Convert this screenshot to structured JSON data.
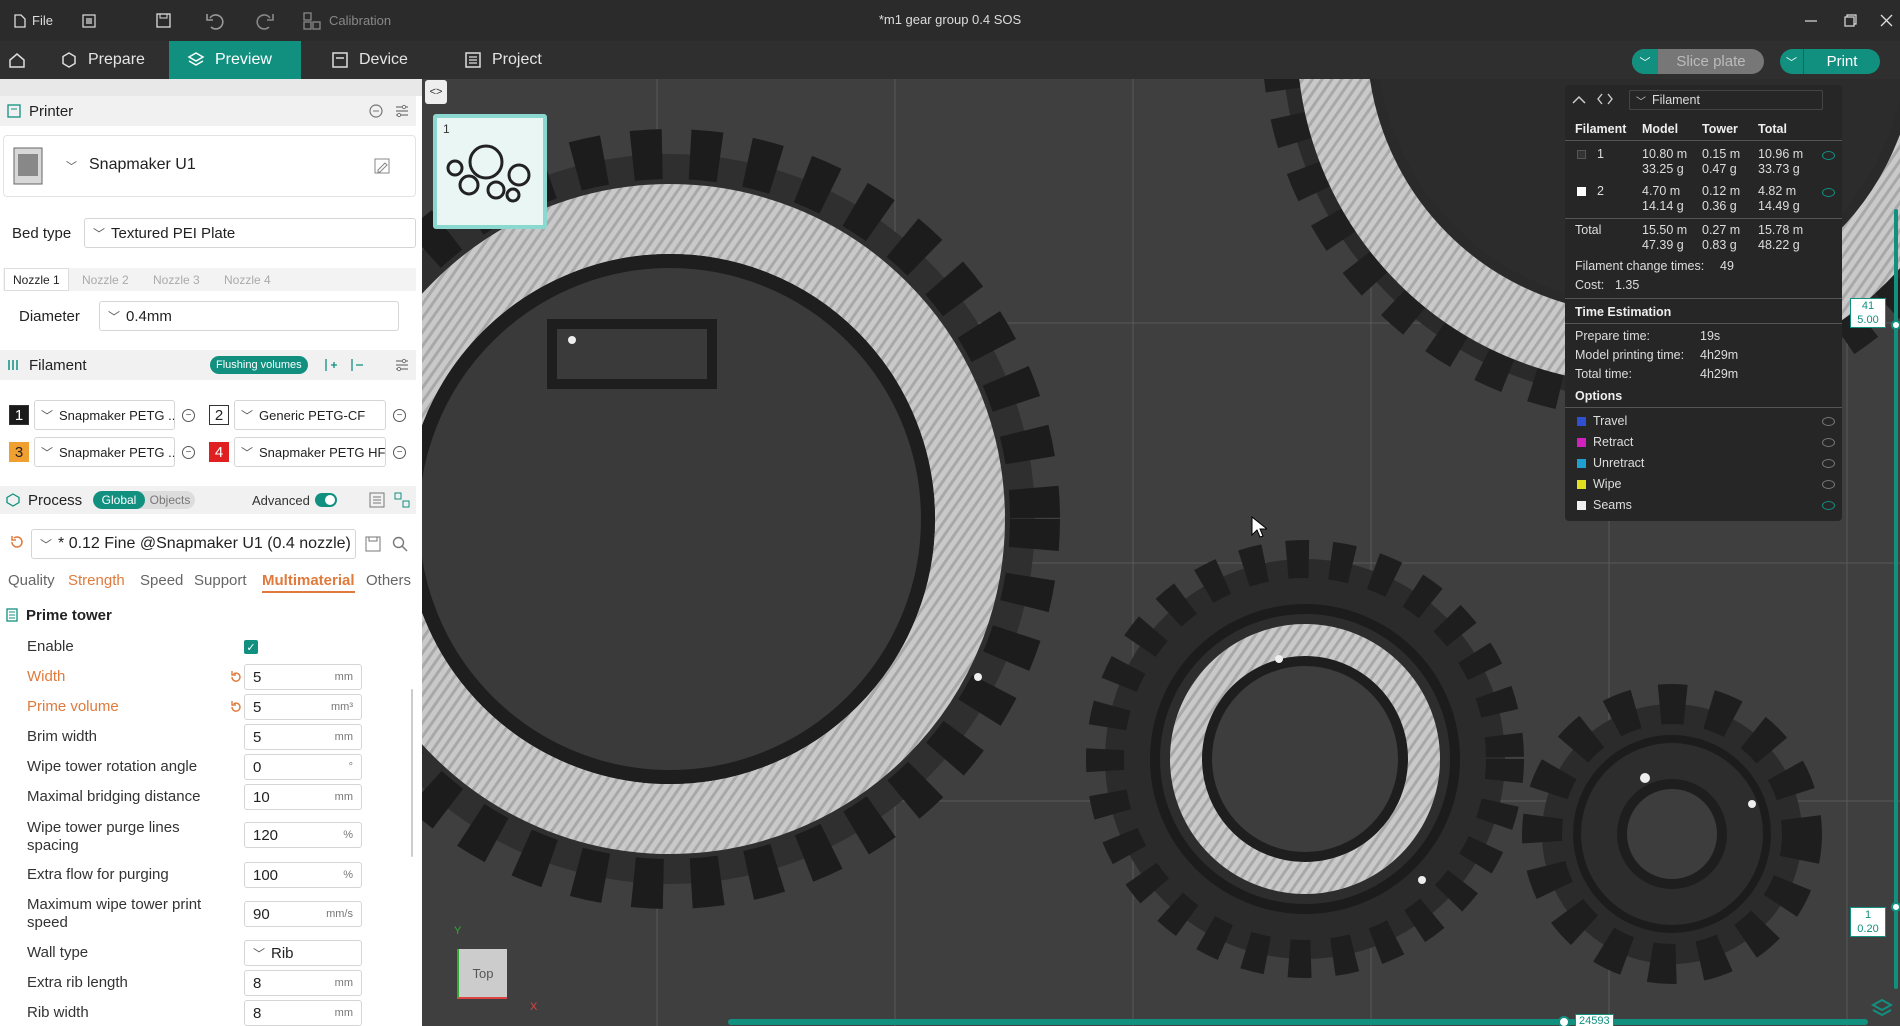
{
  "titlebar": {
    "file_label": "File",
    "calibration_label": "Calibration",
    "window_title": "*m1 gear group 0.4 SOS"
  },
  "tabs": [
    {
      "label": "Prepare"
    },
    {
      "label": "Preview"
    },
    {
      "label": "Device"
    },
    {
      "label": "Project"
    }
  ],
  "actions": {
    "slice_label": "Slice plate",
    "print_label": "Print"
  },
  "printer": {
    "section_title": "Printer",
    "name": "Snapmaker U1",
    "bed_type_label": "Bed type",
    "bed_type_value": "Textured PEI Plate",
    "nozzle_tabs": [
      "Nozzle 1",
      "Nozzle 2",
      "Nozzle 3",
      "Nozzle 4"
    ],
    "diameter_label": "Diameter",
    "diameter_value": "0.4mm"
  },
  "filament": {
    "section_title": "Filament",
    "flushing_label": "Flushing volumes",
    "slots": [
      {
        "num": "1",
        "name": "Snapmaker PETG ...",
        "color": "#1a1a1a",
        "text": "#fff"
      },
      {
        "num": "2",
        "name": "Generic PETG-CF",
        "color": "#ffffff",
        "text": "#222"
      },
      {
        "num": "3",
        "name": "Snapmaker PETG ...",
        "color": "#f0a030",
        "text": "#222"
      },
      {
        "num": "4",
        "name": "Snapmaker PETG HF",
        "color": "#e02020",
        "text": "#fff"
      }
    ]
  },
  "process": {
    "section_title": "Process",
    "global_label": "Global",
    "objects_label": "Objects",
    "advanced_label": "Advanced",
    "preset": "* 0.12 Fine @Snapmaker U1 (0.4 nozzle)",
    "subtabs": [
      "Quality",
      "Strength",
      "Speed",
      "Support",
      "Multimaterial",
      "Others"
    ],
    "group_title": "Prime tower",
    "enable_label": "Enable",
    "rows": [
      {
        "label": "Width",
        "value": "5",
        "unit": "mm",
        "modified": true
      },
      {
        "label": "Prime volume",
        "value": "5",
        "unit": "mm³",
        "modified": true
      },
      {
        "label": "Brim width",
        "value": "5",
        "unit": "mm",
        "modified": false
      },
      {
        "label": "Wipe tower rotation angle",
        "value": "0",
        "unit": "°",
        "modified": false
      },
      {
        "label": "Maximal bridging distance",
        "value": "10",
        "unit": "mm",
        "modified": false
      },
      {
        "label": "Wipe tower purge lines spacing",
        "value": "120",
        "unit": "%",
        "modified": false
      },
      {
        "label": "Extra flow for purging",
        "value": "100",
        "unit": "%",
        "modified": false
      },
      {
        "label": "Maximum wipe tower print speed",
        "value": "90",
        "unit": "mm/s",
        "modified": false
      },
      {
        "label": "Wall type",
        "value": "Rib",
        "unit": "",
        "modified": false
      },
      {
        "label": "Extra rib length",
        "value": "8",
        "unit": "mm",
        "modified": false
      },
      {
        "label": "Rib width",
        "value": "8",
        "unit": "mm",
        "modified": false
      }
    ]
  },
  "viewport": {
    "plate_number": "1",
    "view_cube_label": "Top",
    "axis_y": "Y",
    "axis_x": "X",
    "slider_top_layer": "41",
    "slider_top_height": "5.00",
    "slider_bottom_layer": "1",
    "slider_bottom_height": "0.20",
    "hslider_value": "24593"
  },
  "legend": {
    "dropdown_label": "Filament",
    "headers": [
      "Filament",
      "Model",
      "Tower",
      "Total"
    ],
    "rows": [
      {
        "id": "1",
        "color": "#333333",
        "model_m": "10.80 m",
        "model_g": "33.25 g",
        "tower_m": "0.15 m",
        "tower_g": "0.47 g",
        "total_m": "10.96 m",
        "total_g": "33.73 g"
      },
      {
        "id": "2",
        "color": "#ffffff",
        "model_m": "4.70 m",
        "model_g": "14.14 g",
        "tower_m": "0.12 m",
        "tower_g": "0.36 g",
        "total_m": "4.82 m",
        "total_g": "14.49 g"
      }
    ],
    "total": {
      "label": "Total",
      "model_m": "15.50 m",
      "model_g": "47.39 g",
      "tower_m": "0.27 m",
      "tower_g": "0.83 g",
      "total_m": "15.78 m",
      "total_g": "48.22 g"
    },
    "change_times_label": "Filament change times:",
    "change_times_value": "49",
    "cost_label": "Cost:",
    "cost_value": "1.35",
    "time_title": "Time Estimation",
    "prepare_label": "Prepare time:",
    "prepare_value": "19s",
    "model_time_label": "Model printing time:",
    "model_time_value": "4h29m",
    "total_time_label": "Total time:",
    "total_time_value": "4h29m",
    "options_title": "Options",
    "options": [
      {
        "label": "Travel",
        "color": "#3050d0",
        "visible": false
      },
      {
        "label": "Retract",
        "color": "#d020c0",
        "visible": false
      },
      {
        "label": "Unretract",
        "color": "#20a0d0",
        "visible": false
      },
      {
        "label": "Wipe",
        "color": "#e0e020",
        "visible": false
      },
      {
        "label": "Seams",
        "color": "#f0f0f0",
        "visible": true
      }
    ]
  }
}
